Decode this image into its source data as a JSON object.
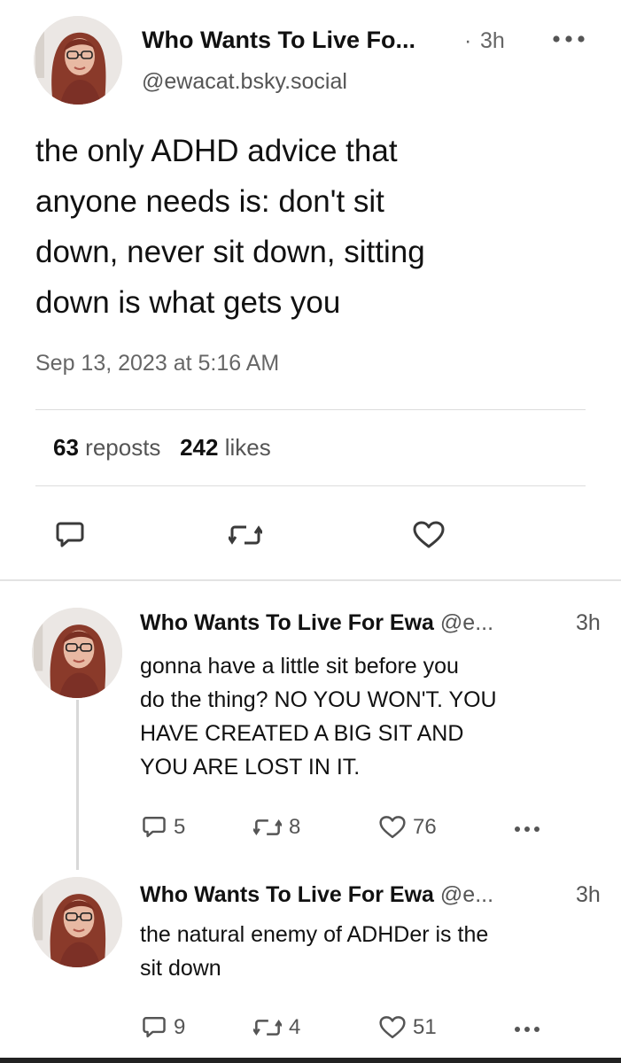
{
  "post": {
    "author_name": "Who Wants To Live Fo...",
    "separator": "·",
    "time": "3h",
    "handle": "@ewacat.bsky.social",
    "text_lines": [
      "the only ADHD advice that",
      "anyone needs is: don't sit",
      "down, never sit down, sitting",
      "down is what gets you"
    ],
    "date": "Sep 13, 2023 at 5:16 AM",
    "reposts_count": "63",
    "reposts_label": "reposts",
    "likes_count": "242",
    "likes_label": "likes",
    "icons": [
      "reply-icon",
      "repost-icon",
      "like-icon",
      "more-icon"
    ]
  },
  "replies": [
    {
      "author_name": "Who Wants To Live For Ewa",
      "handle": "@e...",
      "time": "3h",
      "text_lines": [
        "gonna have a little sit before you",
        "do the thing? NO YOU WON'T. YOU",
        "HAVE CREATED A BIG SIT AND",
        "YOU ARE LOST IN IT."
      ],
      "replies_count": "5",
      "reposts_count": "8",
      "likes_count": "76"
    },
    {
      "author_name": "Who Wants To Live For Ewa",
      "handle": "@e...",
      "time": "3h",
      "text_lines": [
        "the natural enemy of ADHDer is the",
        "sit down"
      ],
      "replies_count": "9",
      "reposts_count": "4",
      "likes_count": "51"
    }
  ],
  "colors": {
    "text": "#111111",
    "muted": "#555555",
    "icon": "#3a3a3a",
    "divider": "#dcdcdc"
  }
}
